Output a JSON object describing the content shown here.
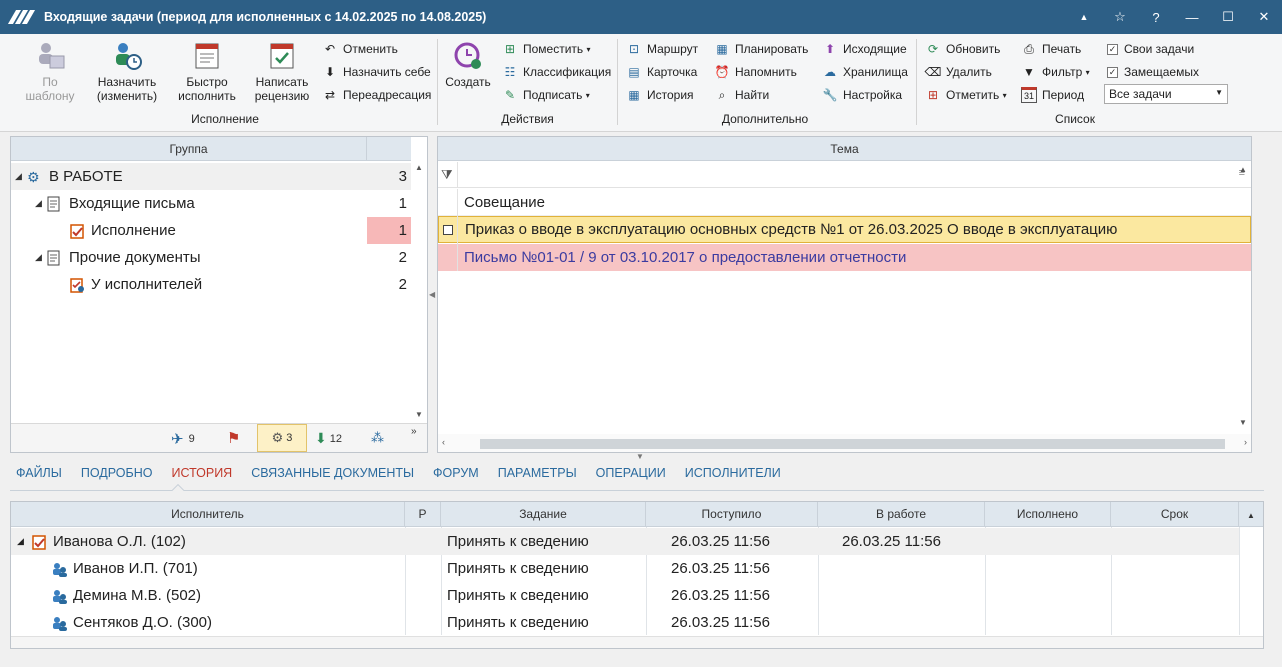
{
  "window": {
    "title": "Входящие задачи (период для исполненных с 14.02.2025 по 14.08.2025)",
    "controls": [
      "▲",
      "☆",
      "?",
      "—",
      "☐",
      "✕"
    ]
  },
  "ribbon": {
    "groups": {
      "execution": "Исполнение",
      "actions": "Действия",
      "extra": "Дополнительно",
      "list": "Список"
    },
    "by_template": "По\nшаблону",
    "assign": "Назначить\n(изменить)",
    "quick_execute": "Быстро\nисполнить",
    "write_review": "Написать\nрецензию",
    "cancel": "Отменить",
    "assign_self": "Назначить себе",
    "redirect": "Переадресация",
    "create": "Создать",
    "place": "Поместить",
    "classify": "Классификация",
    "sign": "Подписать",
    "route": "Маршрут",
    "card": "Карточка",
    "history": "История",
    "plan": "Планировать",
    "remind": "Напомнить",
    "find": "Найти",
    "outgoing": "Исходящие",
    "storage": "Хранилища",
    "settings": "Настройка",
    "refresh": "Обновить",
    "delete": "Удалить",
    "mark": "Отметить",
    "print": "Печать",
    "filter": "Фильтр",
    "period": "Период",
    "own_tasks": "Свои задачи",
    "substituted": "Замещаемых",
    "task_filter_value": "Все задачи"
  },
  "left_panel": {
    "header": "Группа",
    "tree": [
      {
        "label": "В РАБОТЕ",
        "count": "3"
      },
      {
        "label": "Входящие письма",
        "count": "1"
      },
      {
        "label": "Исполнение",
        "count": "1"
      },
      {
        "label": "Прочие документы",
        "count": "2"
      },
      {
        "label": "У исполнителей",
        "count": "2"
      }
    ],
    "status_bar": {
      "flights": "9",
      "settings": "3",
      "downloads": "12"
    }
  },
  "right_panel": {
    "header": "Тема",
    "rows": [
      {
        "text": "Совещание"
      },
      {
        "text": "Приказ о вводе в эксплуатацию основных средств №1 от 26.03.2025 О вводе в эксплуатацию"
      },
      {
        "text": "Письмо №01-01 / 9 от 03.10.2017 о предоставлении отчетности"
      }
    ]
  },
  "tabs": [
    "ФАЙЛЫ",
    "ПОДРОБНО",
    "ИСТОРИЯ",
    "СВЯЗАННЫЕ ДОКУМЕНТЫ",
    "ФОРУМ",
    "ПАРАМЕТРЫ",
    "ОПЕРАЦИИ",
    "ИСПОЛНИТЕЛИ"
  ],
  "history_grid": {
    "columns": [
      "Исполнитель",
      "Р",
      "Задание",
      "Поступило",
      "В работе",
      "Исполнено",
      "Срок"
    ],
    "rows": [
      {
        "executor": "Иванова О.Л. (102)",
        "task": "Принять к сведению",
        "received": "26.03.25 11:56",
        "in_work": "26.03.25 11:56"
      },
      {
        "executor": "Иванов И.П. (701)",
        "task": "Принять к сведению",
        "received": "26.03.25 11:56",
        "in_work": ""
      },
      {
        "executor": "Демина М.В. (502)",
        "task": "Принять к сведению",
        "received": "26.03.25 11:56",
        "in_work": ""
      },
      {
        "executor": "Сентяков Д.О. (300)",
        "task": "Принять к сведению",
        "received": "26.03.25 11:56",
        "in_work": ""
      }
    ]
  }
}
